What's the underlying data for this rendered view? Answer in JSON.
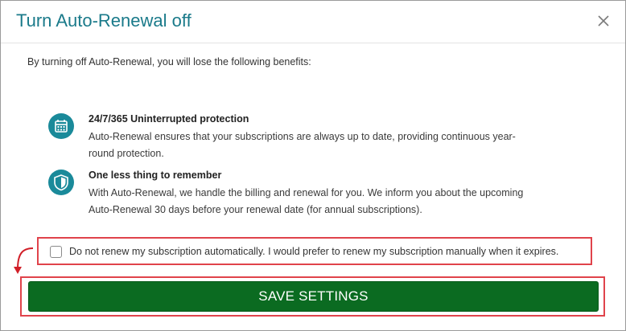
{
  "dialog": {
    "title": "Turn Auto-Renewal off",
    "close_icon": "close-icon"
  },
  "intro": "By turning off Auto-Renewal, you will lose the following benefits:",
  "benefits": [
    {
      "icon": "calendar-icon",
      "title": "24/7/365 Uninterrupted protection",
      "description": "Auto-Renewal ensures that your subscriptions are always up to date, providing continuous year-round protection."
    },
    {
      "icon": "shield-check-icon",
      "title": "One less thing to remember",
      "description": "With Auto-Renewal, we handle the billing and renewal for you. We inform you about the upcoming Auto-Renewal 30 days before your renewal date (for annual subscriptions)."
    }
  ],
  "checkbox": {
    "label": "Do not renew my subscription automatically. I would prefer to renew my subscription manually when it expires.",
    "checked": false
  },
  "save_button": {
    "label": "SAVE SETTINGS"
  },
  "colors": {
    "title": "#1a7a8a",
    "icon_bg": "#1a8a9a",
    "button_bg": "#0b6b21",
    "highlight": "#e0434b"
  }
}
